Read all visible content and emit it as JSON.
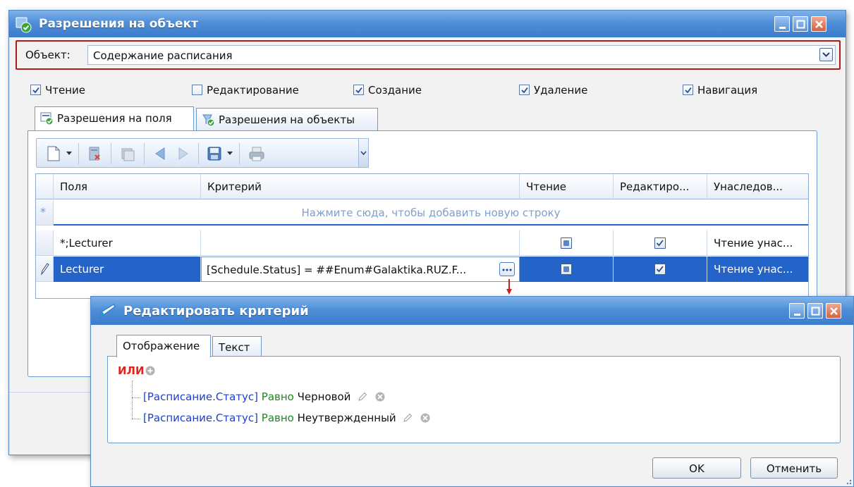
{
  "main_window": {
    "title": "Разрешения на объект",
    "object": {
      "label": "Объект:",
      "value": "Содержание расписания"
    },
    "permissions": [
      {
        "label": "Чтение",
        "checked": true
      },
      {
        "label": "Редактирование",
        "checked": false
      },
      {
        "label": "Создание",
        "checked": true
      },
      {
        "label": "Удаление",
        "checked": true
      },
      {
        "label": "Навигация",
        "checked": true
      }
    ],
    "tabs": [
      {
        "label": "Разрешения на поля",
        "active": true
      },
      {
        "label": "Разрешения на объекты",
        "active": false
      }
    ],
    "grid": {
      "columns": [
        "Поля",
        "Критерий",
        "Чтение",
        "Редактиро...",
        "Унаследов..."
      ],
      "new_row_hint": "Нажмите сюда, чтобы добавить новую строку",
      "rows": [
        {
          "field": "*;Lecturer",
          "criterion": "",
          "read": "indeterminate",
          "edit": true,
          "inherited": "Чтение унас...",
          "selected": false
        },
        {
          "field": "Lecturer",
          "criterion": "[Schedule.Status] = ##Enum#Galaktika.RUZ.F...",
          "read": "indeterminate",
          "edit": true,
          "inherited": "Чтение унас...",
          "selected": true
        }
      ]
    }
  },
  "criteria_dialog": {
    "title": "Редактировать критерий",
    "tabs": [
      {
        "label": "Отображение",
        "active": true
      },
      {
        "label": "Текст",
        "active": false
      }
    ],
    "group_operator": "ИЛИ",
    "conditions": [
      {
        "field": "[Расписание.Статус]",
        "operator": "Равно",
        "value": "Черновой"
      },
      {
        "field": "[Расписание.Статус]",
        "operator": "Равно",
        "value": "Неутвержденный"
      }
    ],
    "buttons": {
      "ok": "OK",
      "cancel": "Отменить"
    }
  },
  "colors": {
    "titlebar": "#4f8fd8",
    "highlight_border": "#b01c1c",
    "selection": "#2464c8",
    "group_operator": "#e0241b",
    "condition_field": "#1c3fd0",
    "condition_operator": "#1d8a1a"
  }
}
